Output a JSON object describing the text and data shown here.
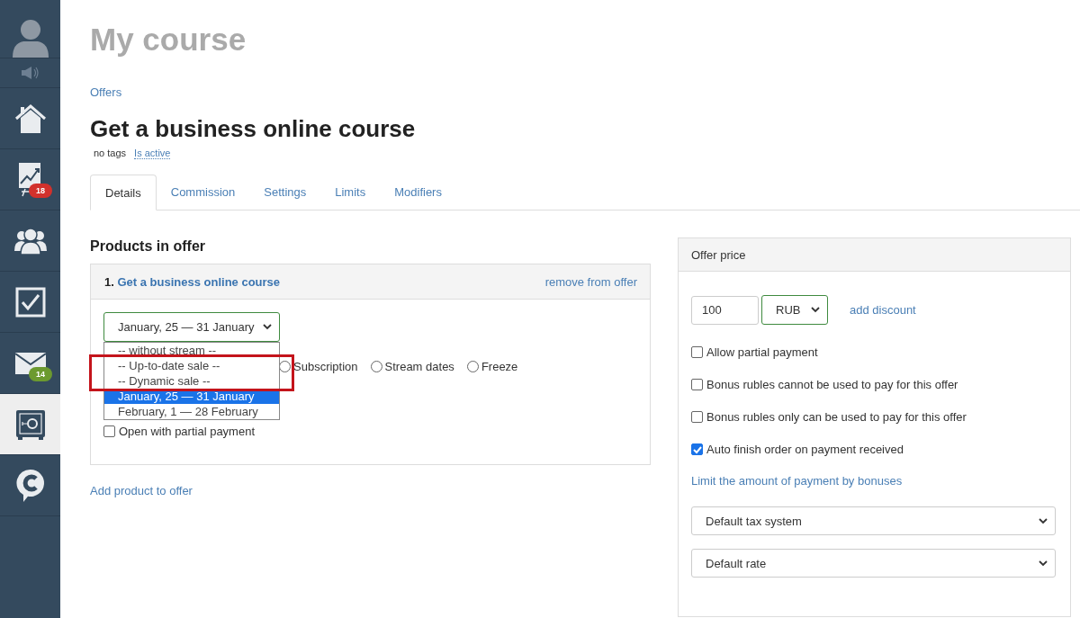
{
  "sidebar": {
    "items": [
      {
        "kind": "avatar",
        "selected": false
      },
      {
        "kind": "speaker",
        "selected": false
      },
      {
        "kind": "home",
        "selected": false
      },
      {
        "kind": "chart",
        "selected": false,
        "badge": {
          "count": "18",
          "color": "#d2312c"
        }
      },
      {
        "kind": "people",
        "selected": false
      },
      {
        "kind": "task",
        "selected": false
      },
      {
        "kind": "mail",
        "selected": false,
        "badge": {
          "count": "14",
          "color": "#6c9a2f"
        }
      },
      {
        "kind": "safe",
        "selected": true
      },
      {
        "kind": "chat",
        "selected": false
      }
    ]
  },
  "page_title": "My course",
  "breadcrumb": "Offers",
  "heading": "Get a business online course",
  "meta": {
    "tags": "no tags",
    "status": "Is active"
  },
  "tabs": [
    {
      "label": "Details",
      "selected": true
    },
    {
      "label": "Commission",
      "selected": false
    },
    {
      "label": "Settings",
      "selected": false
    },
    {
      "label": "Limits",
      "selected": false
    },
    {
      "label": "Modifiers",
      "selected": false
    }
  ],
  "products": {
    "title": "Products in offer",
    "items": [
      {
        "number": "1.",
        "name": "Get a business online course",
        "remove": "remove from offer",
        "stream_select": {
          "value": "January, 25 — 31 January",
          "expanded": true,
          "options": [
            {
              "label": "-- without stream --",
              "selected": false
            },
            {
              "label": "-- Up-to-date sale --",
              "selected": false
            },
            {
              "label": "-- Dynamic sale --",
              "selected": false
            },
            {
              "label": "January, 25 — 31 January",
              "selected": true
            },
            {
              "label": "February, 1 — 28 February",
              "selected": false
            }
          ]
        },
        "access_options": [
          {
            "label": "Subscription",
            "selected": false
          },
          {
            "label": "Stream dates",
            "selected": false
          },
          {
            "label": "Freeze",
            "selected": false
          }
        ],
        "partial_payment": {
          "label": "Open with partial payment",
          "checked": false
        }
      }
    ],
    "add_link": "Add product to offer"
  },
  "offer_price": {
    "title": "Offer price",
    "amount": "100",
    "currency": "RUB",
    "add_discount": "add discount",
    "options": [
      {
        "label": "Allow partial payment",
        "checked": false
      },
      {
        "label": "Bonus rubles cannot be used to pay for this offer",
        "checked": false
      },
      {
        "label": "Bonus rubles only can be used to pay for this offer",
        "checked": false
      },
      {
        "label": "Auto finish order on payment received",
        "checked": true
      }
    ],
    "bonus_limit_link": "Limit the amount of payment by bonuses",
    "tax_system": "Default tax system",
    "rate": "Default rate"
  }
}
